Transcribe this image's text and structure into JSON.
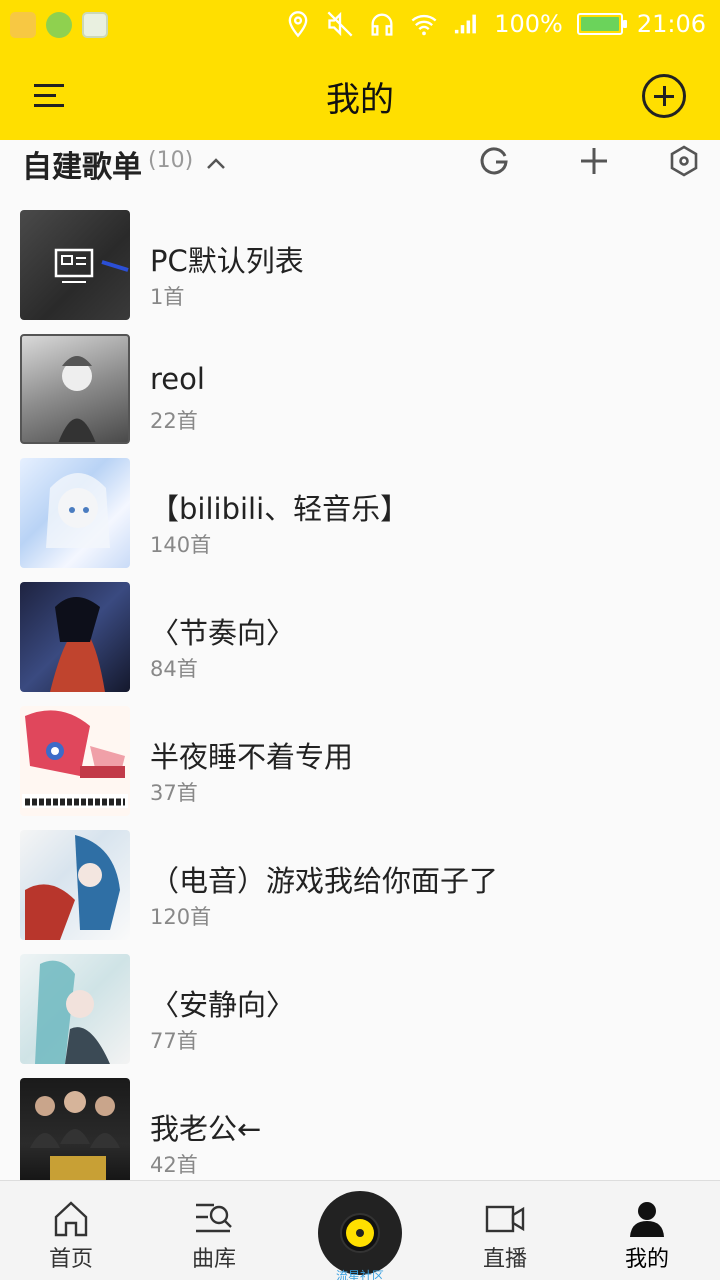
{
  "status_bar": {
    "battery": "100%",
    "time": "21:06",
    "icons": [
      "location-icon",
      "mute-icon",
      "headphones-icon",
      "wifi-icon",
      "signal-icon",
      "battery-icon"
    ]
  },
  "header": {
    "title": "我的",
    "left_icon": "menu-icon",
    "right_icon": "add-circle-icon"
  },
  "section": {
    "title": "自建歌单",
    "count": "(10)",
    "icons": [
      "chevron-up-icon",
      "import-icon",
      "plus-icon",
      "settings-icon"
    ]
  },
  "playlists": [
    {
      "name": "PC默认列表",
      "count": "1首"
    },
    {
      "name": "reol",
      "count": "22首"
    },
    {
      "name": "【bilibili、轻音乐】",
      "count": "140首"
    },
    {
      "name": "〈节奏向〉",
      "count": "84首"
    },
    {
      "name": "半夜睡不着专用",
      "count": "37首"
    },
    {
      "name": "（电音）游戏我给你面子了",
      "count": "120首"
    },
    {
      "name": "〈安静向〉",
      "count": "77首"
    },
    {
      "name": "我老公←",
      "count": "42首"
    }
  ],
  "bottom_nav": {
    "home": "首页",
    "library": "曲库",
    "center": "流星社区",
    "live": "直播",
    "mine": "我的"
  },
  "colors": {
    "accent": "#ffdf00",
    "background": "#fafafa",
    "nav_background": "#f4f4f4"
  }
}
